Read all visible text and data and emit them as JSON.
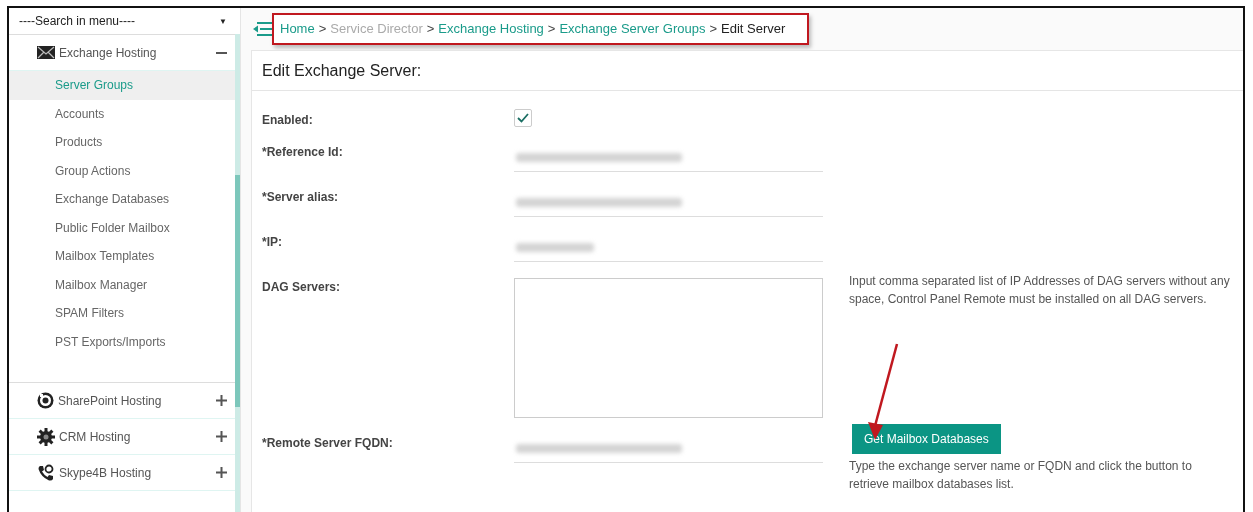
{
  "sidebar": {
    "search": {
      "value": "----Search in menu----",
      "caret": "▼"
    },
    "groups": [
      {
        "label": "Exchange Hosting",
        "expanded": true,
        "items": [
          {
            "label": "Server Groups",
            "selected": true
          },
          {
            "label": "Accounts",
            "selected": false
          },
          {
            "label": "Products",
            "selected": false
          },
          {
            "label": "Group Actions",
            "selected": false
          },
          {
            "label": "Exchange Databases",
            "selected": false
          },
          {
            "label": "Public Folder Mailbox",
            "selected": false
          },
          {
            "label": "Mailbox Templates",
            "selected": false
          },
          {
            "label": "Mailbox Manager",
            "selected": false
          },
          {
            "label": "SPAM Filters",
            "selected": false
          },
          {
            "label": "PST Exports/Imports",
            "selected": false
          }
        ]
      },
      {
        "label": "SharePoint Hosting",
        "expanded": false
      },
      {
        "label": "CRM Hosting",
        "expanded": false
      },
      {
        "label": "Skype4B Hosting",
        "expanded": false
      }
    ]
  },
  "breadcrumb": [
    {
      "label": "Home",
      "kind": "link"
    },
    {
      "label": "Service Director",
      "kind": "muted"
    },
    {
      "label": "Exchange Hosting",
      "kind": "link"
    },
    {
      "label": "Exchange Server Groups",
      "kind": "link"
    },
    {
      "label": "Edit Server",
      "kind": "current"
    }
  ],
  "breadcrumb_separator": ">",
  "form": {
    "title": "Edit Exchange Server:",
    "fields": [
      {
        "label": "Enabled:",
        "kind": "checkbox",
        "checked": true
      },
      {
        "label": "*Reference Id:",
        "kind": "text",
        "redacted": true
      },
      {
        "label": "*Server alias:",
        "kind": "text",
        "redacted": true
      },
      {
        "label": "*IP:",
        "kind": "ip",
        "redacted": true
      },
      {
        "label": "DAG Servers:",
        "kind": "textarea",
        "help": "Input comma separated list of IP Addresses of DAG servers without any space, Control Panel Remote must be installed on all DAG servers."
      },
      {
        "label": "*Remote Server FQDN:",
        "kind": "text",
        "redacted": true,
        "button": "Get Mailbox Databases",
        "help": "Type the exchange server name or FQDN and click the button to retrieve mailbox databases list."
      }
    ]
  }
}
